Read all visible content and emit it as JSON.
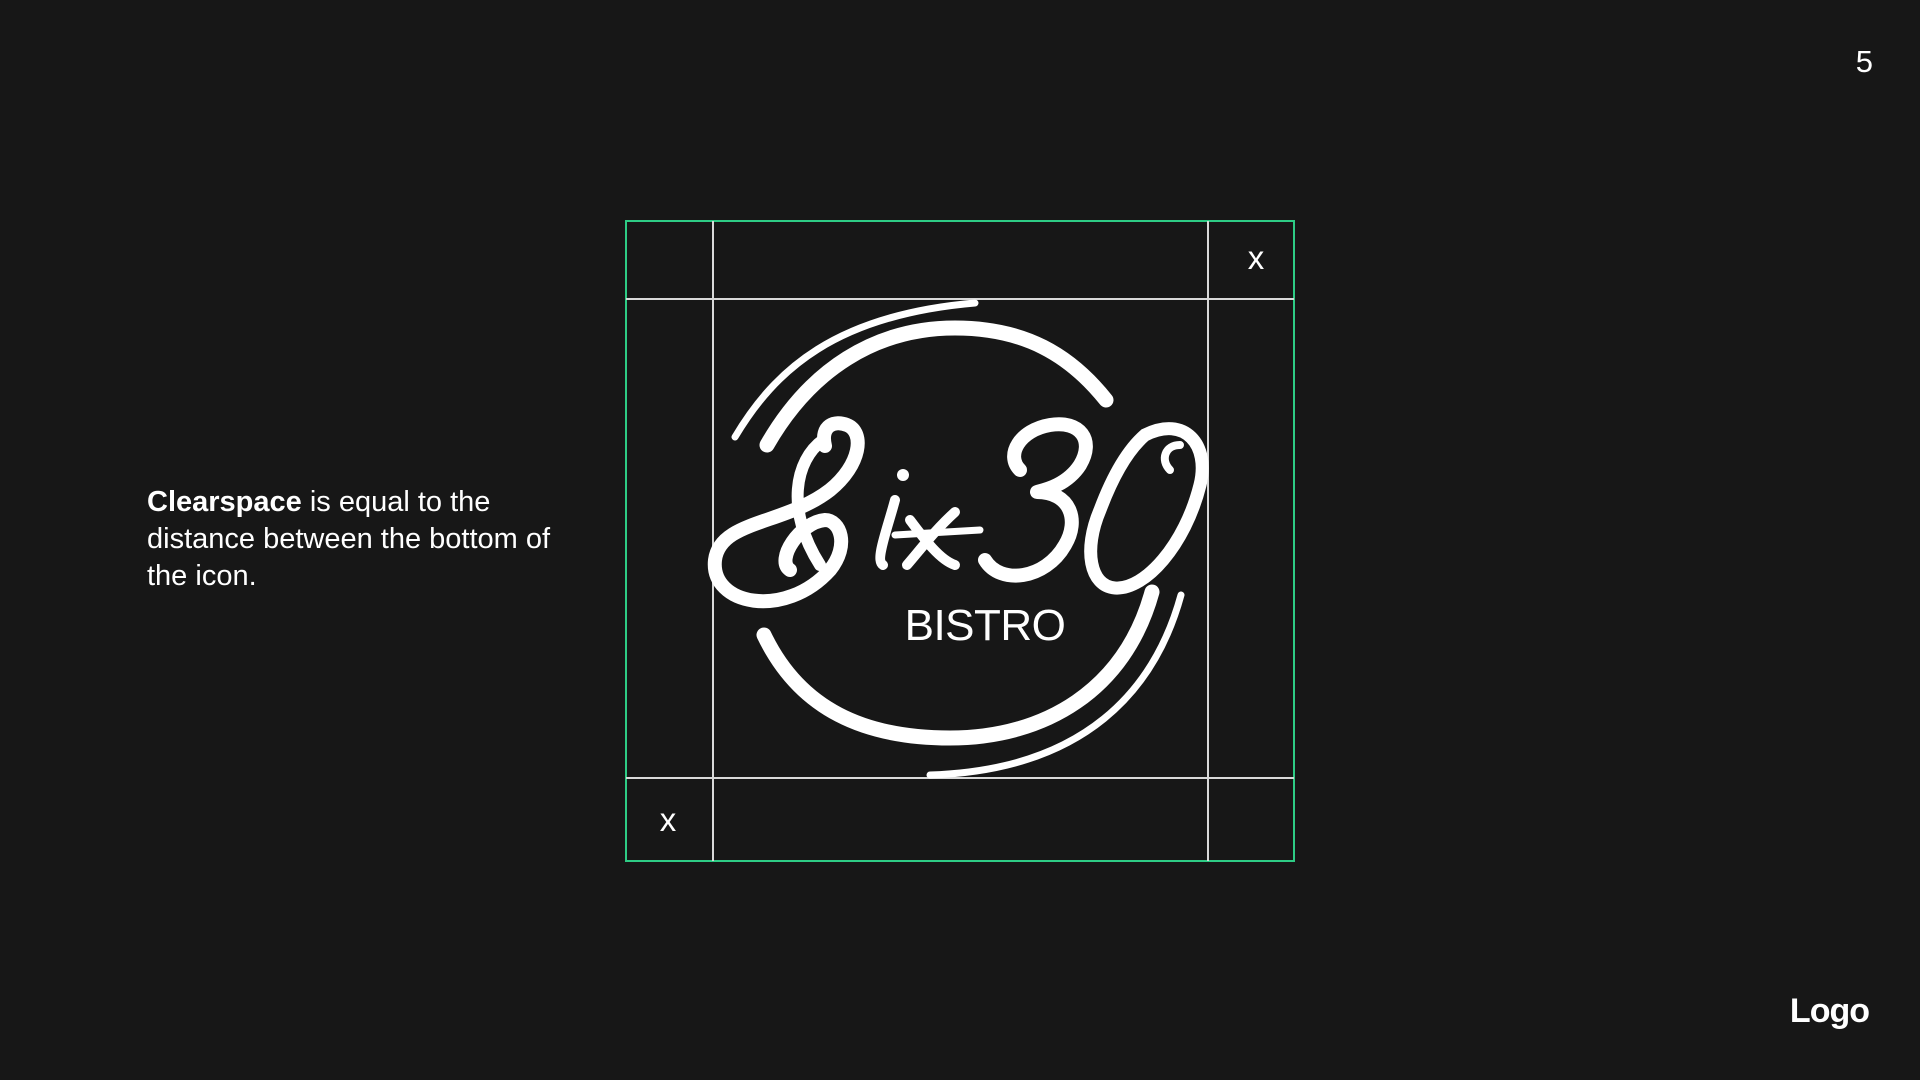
{
  "page": {
    "number": "5",
    "section": "Logo"
  },
  "description": {
    "bold": "Clearspace",
    "rest": " is equal to the distance between the bottom of the icon."
  },
  "diagram": {
    "clearspace_label_top": "x",
    "clearspace_label_bottom": "x",
    "logo_wordmark": "Six30",
    "logo_subtitle": "BISTRO",
    "outer_frame_color": "#2ecc85",
    "guide_line_color": "#d9d9d9",
    "logo_color": "#ffffff"
  }
}
